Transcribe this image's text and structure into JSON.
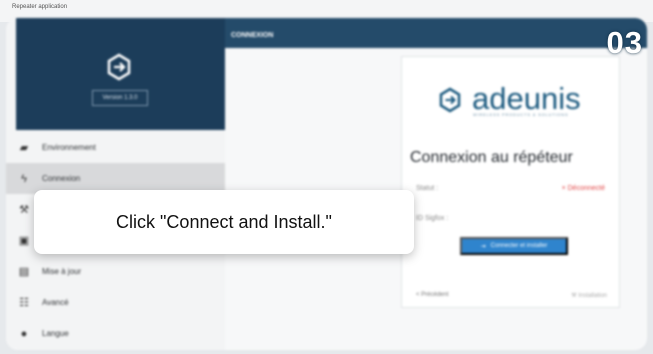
{
  "window": {
    "title": "Repeater application"
  },
  "sidebar": {
    "version": "Version 1.3.0",
    "items": [
      {
        "label": "Environnement",
        "icon": "folder-icon"
      },
      {
        "label": "Connexion",
        "icon": "plug-icon",
        "active": true
      },
      {
        "label": "",
        "icon": "wrench-icon"
      },
      {
        "label": "",
        "icon": "image-icon"
      },
      {
        "label": "Mise à jour",
        "icon": "update-icon"
      },
      {
        "label": "Avancé",
        "icon": "sliders-icon"
      },
      {
        "label": "Langue",
        "icon": "globe-icon"
      }
    ]
  },
  "main": {
    "header": "CONNEXION",
    "step_number": "03"
  },
  "card": {
    "brand": "adeunis",
    "brand_tagline": "WIRELESS PRODUCTS & SOLUTIONS",
    "title": "Connexion au répéteur",
    "status_label": "Statut :",
    "status_value": "× Déconnecté",
    "sigfox_label": "ID Sigfox :",
    "connect_button": "Connecter et installer",
    "previous_label": "< Précédent",
    "installation_label": "Installation"
  },
  "tooltip": {
    "text": "Click \"Connect and Install.\""
  },
  "colors": {
    "sidebar_header": "#1c3d5a",
    "main_header": "#244b6a",
    "primary_button": "#2f84cd",
    "error": "#e24747"
  }
}
